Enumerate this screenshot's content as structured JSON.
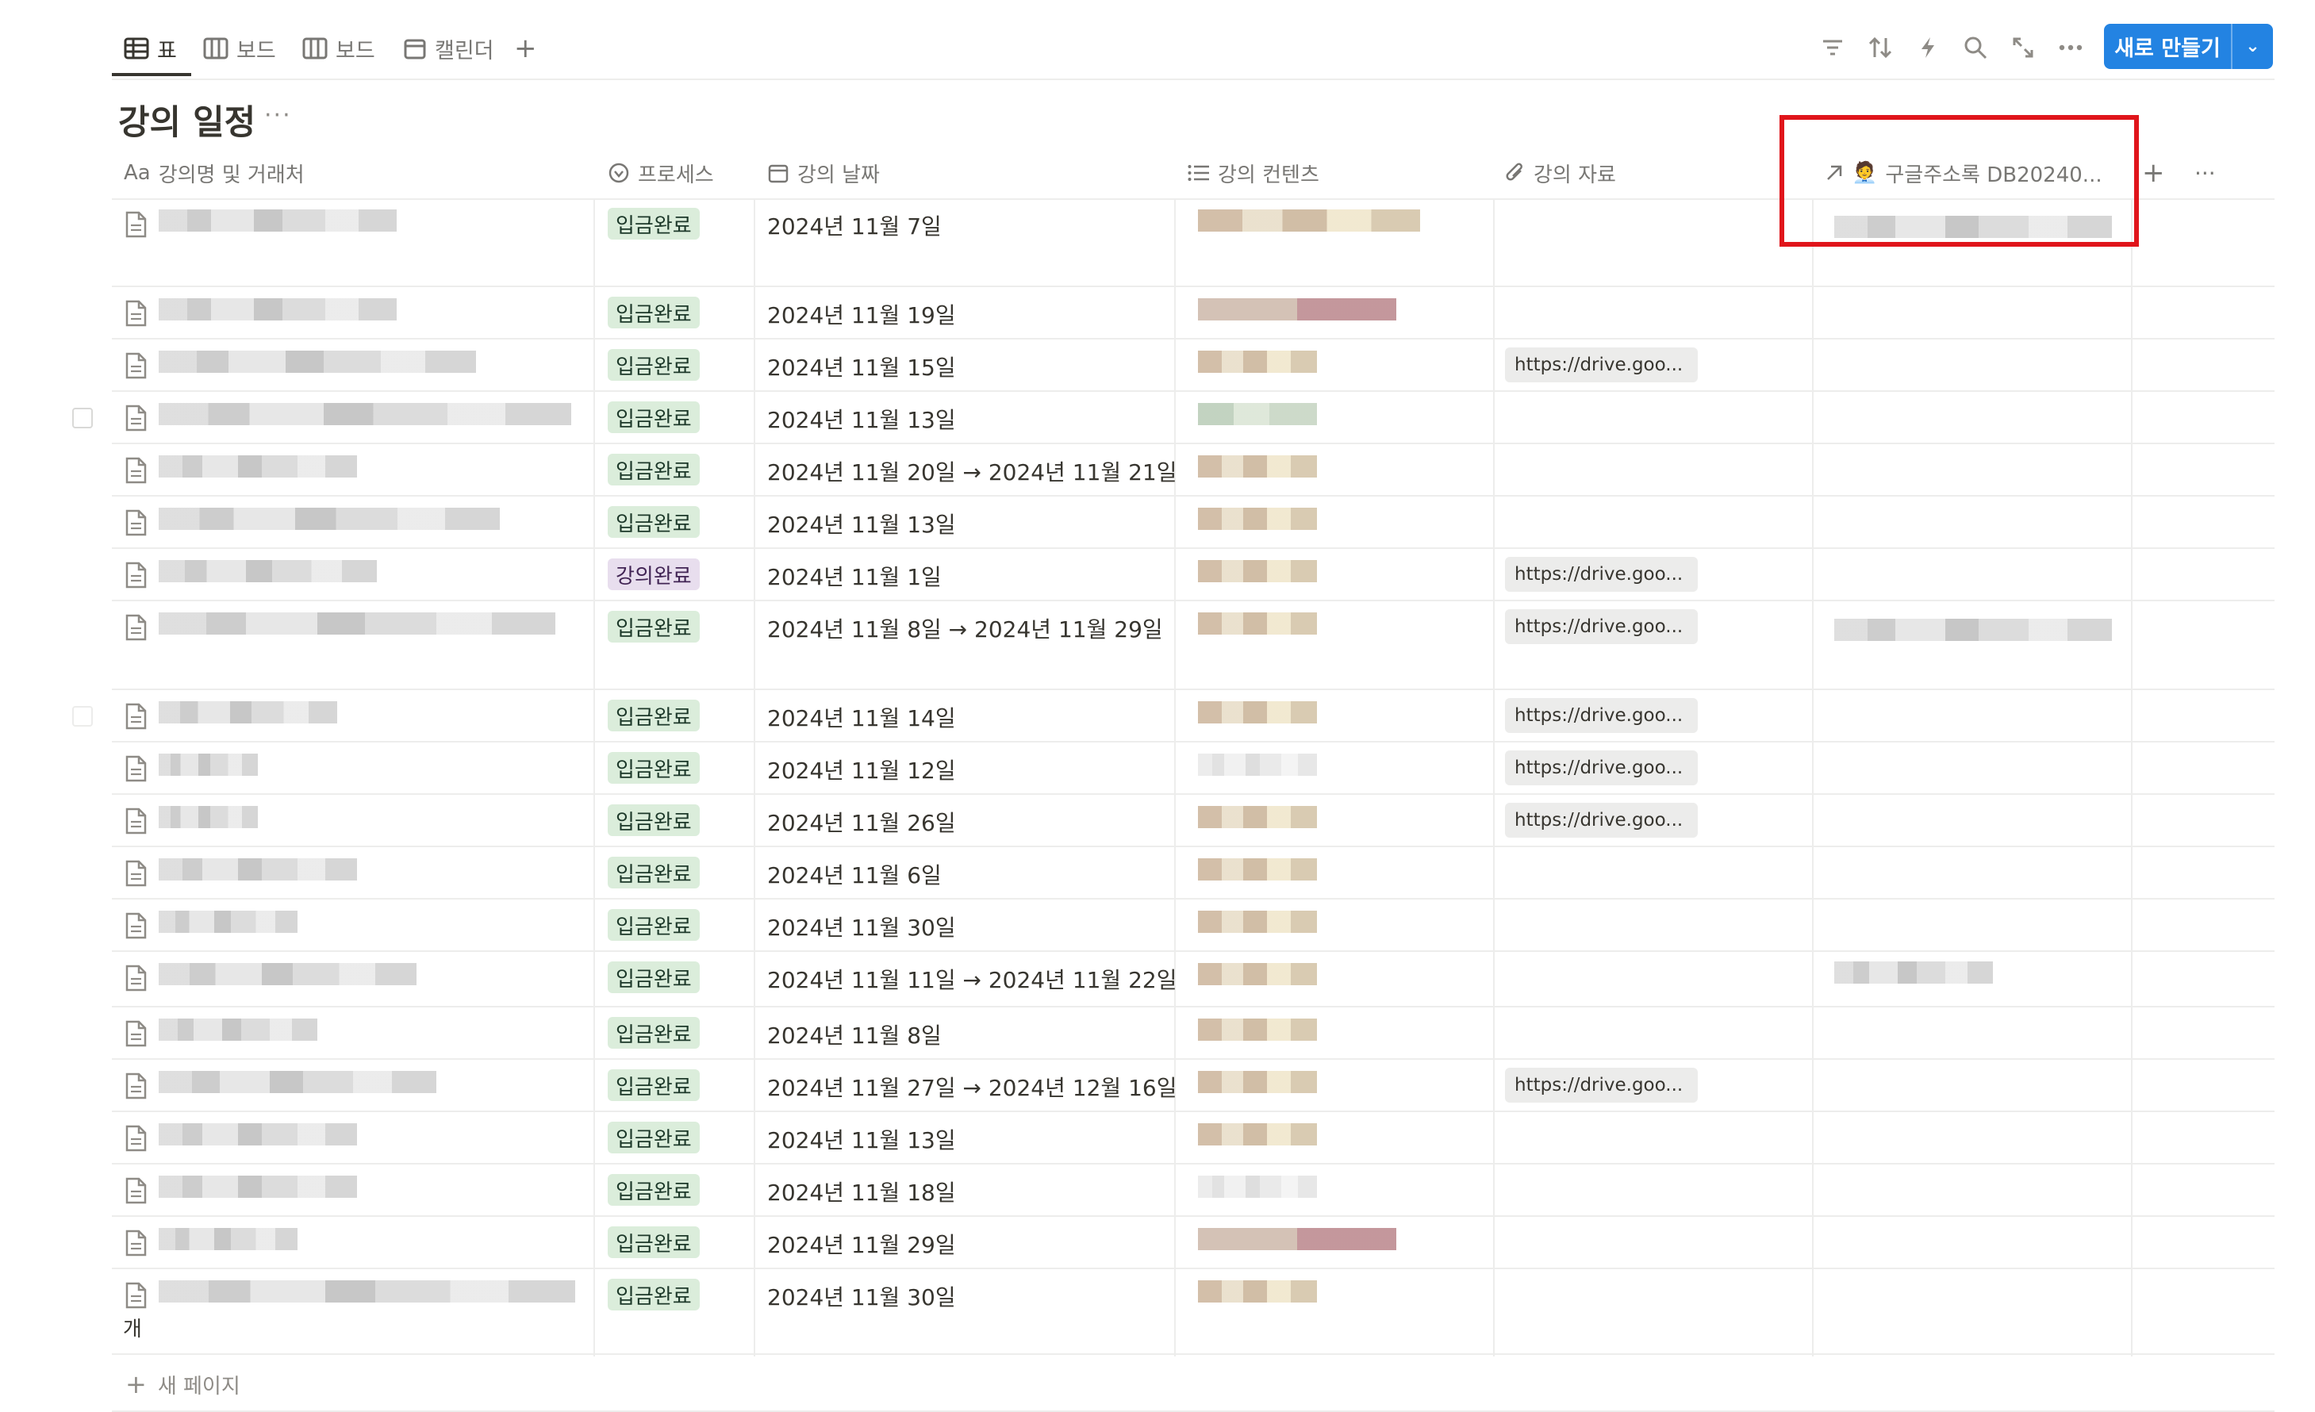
{
  "views": [
    {
      "icon": "table-icon",
      "label": "표",
      "active": true
    },
    {
      "icon": "board-icon",
      "label": "보드",
      "active": false
    },
    {
      "icon": "board-icon",
      "label": "보드",
      "active": false
    },
    {
      "icon": "calendar-icon",
      "label": "캘린더",
      "active": false
    }
  ],
  "toolbar": {
    "new_button_label": "새로 만들기",
    "icons": [
      "filter-icon",
      "sort-icon",
      "automation-icon",
      "search-icon",
      "expand-icon",
      "more-icon"
    ]
  },
  "database_title": "강의 일정",
  "columns": [
    {
      "prefix": "Aa",
      "icon": "text-icon",
      "label": "강의명 및 거래처"
    },
    {
      "icon": "status-icon",
      "label": "프로세스"
    },
    {
      "icon": "calendar-icon",
      "label": "강의 날짜"
    },
    {
      "icon": "list-icon",
      "label": "강의 컨텐츠"
    },
    {
      "icon": "paperclip-icon",
      "label": "강의 자료"
    },
    {
      "icon": "relation-arrow-icon",
      "emoji": "🧑‍💼",
      "label": "구글주소록 DB20240..."
    }
  ],
  "rows": [
    {
      "status": "입금완료",
      "status_color": "green",
      "date": "2024년 11월 7일",
      "file": ""
    },
    {
      "status": "입금완료",
      "status_color": "green",
      "date": "2024년 11월 19일",
      "file": ""
    },
    {
      "status": "입금완료",
      "status_color": "green",
      "date": "2024년 11월 15일",
      "file": "https://drive.goo..."
    },
    {
      "status": "입금완료",
      "status_color": "green",
      "date": "2024년 11월 13일",
      "file": ""
    },
    {
      "status": "입금완료",
      "status_color": "green",
      "date": "2024년 11월 20일 → 2024년 11월 21일",
      "file": ""
    },
    {
      "status": "입금완료",
      "status_color": "green",
      "date": "2024년 11월 13일",
      "file": ""
    },
    {
      "status": "강의완료",
      "status_color": "purple",
      "date": "2024년 11월 1일",
      "file": "https://drive.goo..."
    },
    {
      "status": "입금완료",
      "status_color": "green",
      "date": "2024년 11월 8일 → 2024년 11월 29일",
      "file": "https://drive.goo..."
    },
    {
      "status": "입금완료",
      "status_color": "green",
      "date": "2024년 11월 14일",
      "file": "https://drive.goo..."
    },
    {
      "status": "입금완료",
      "status_color": "green",
      "date": "2024년 11월 12일",
      "file": "https://drive.goo..."
    },
    {
      "status": "입금완료",
      "status_color": "green",
      "date": "2024년 11월 26일",
      "file": "https://drive.goo..."
    },
    {
      "status": "입금완료",
      "status_color": "green",
      "date": "2024년 11월 6일",
      "file": ""
    },
    {
      "status": "입금완료",
      "status_color": "green",
      "date": "2024년 11월 30일",
      "file": ""
    },
    {
      "status": "입금완료",
      "status_color": "green",
      "date": "2024년 11월 11일 → 2024년 11월 22일",
      "file": ""
    },
    {
      "status": "입금완료",
      "status_color": "green",
      "date": "2024년 11월 8일",
      "file": ""
    },
    {
      "status": "입금완료",
      "status_color": "green",
      "date": "2024년 11월 27일 → 2024년 12월 16일",
      "file": "https://drive.goo..."
    },
    {
      "status": "입금완료",
      "status_color": "green",
      "date": "2024년 11월 13일",
      "file": ""
    },
    {
      "status": "입금완료",
      "status_color": "green",
      "date": "2024년 11월 18일",
      "file": ""
    },
    {
      "status": "입금완료",
      "status_color": "green",
      "date": "2024년 11월 29일",
      "file": ""
    },
    {
      "status": "입금완료",
      "status_color": "green",
      "date": "2024년 11월 30일",
      "file": ""
    }
  ],
  "last_row_partial_text": "개 ",
  "new_page_label": "새 페이지",
  "colors": {
    "accent": "#2383e2",
    "highlight": "#e0151b",
    "tag_green": "#dbeddb",
    "tag_purple": "#e8deee"
  }
}
